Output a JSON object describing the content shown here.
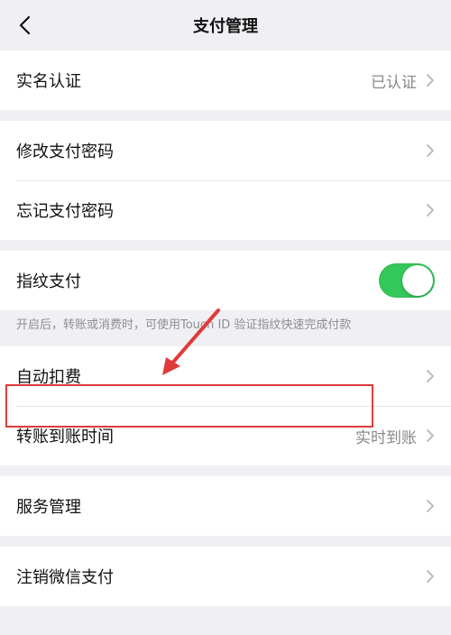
{
  "header": {
    "title": "支付管理"
  },
  "sections": {
    "realname": {
      "label": "实名认证",
      "value": "已认证"
    },
    "password": {
      "change_label": "修改支付密码",
      "forgot_label": "忘记支付密码"
    },
    "fingerprint": {
      "label": "指纹支付",
      "toggle_on": true,
      "hint": "开启后，转账或消费时，可使用Touch ID 验证指纹快速完成付款"
    },
    "autopay": {
      "label": "自动扣费"
    },
    "transfer": {
      "label": "转账到账时间",
      "value": "实时到账"
    },
    "service": {
      "label": "服务管理"
    },
    "cancel": {
      "label": "注销微信支付"
    }
  },
  "colors": {
    "toggle_on": "#34c759",
    "highlight": "#e13a3a"
  }
}
